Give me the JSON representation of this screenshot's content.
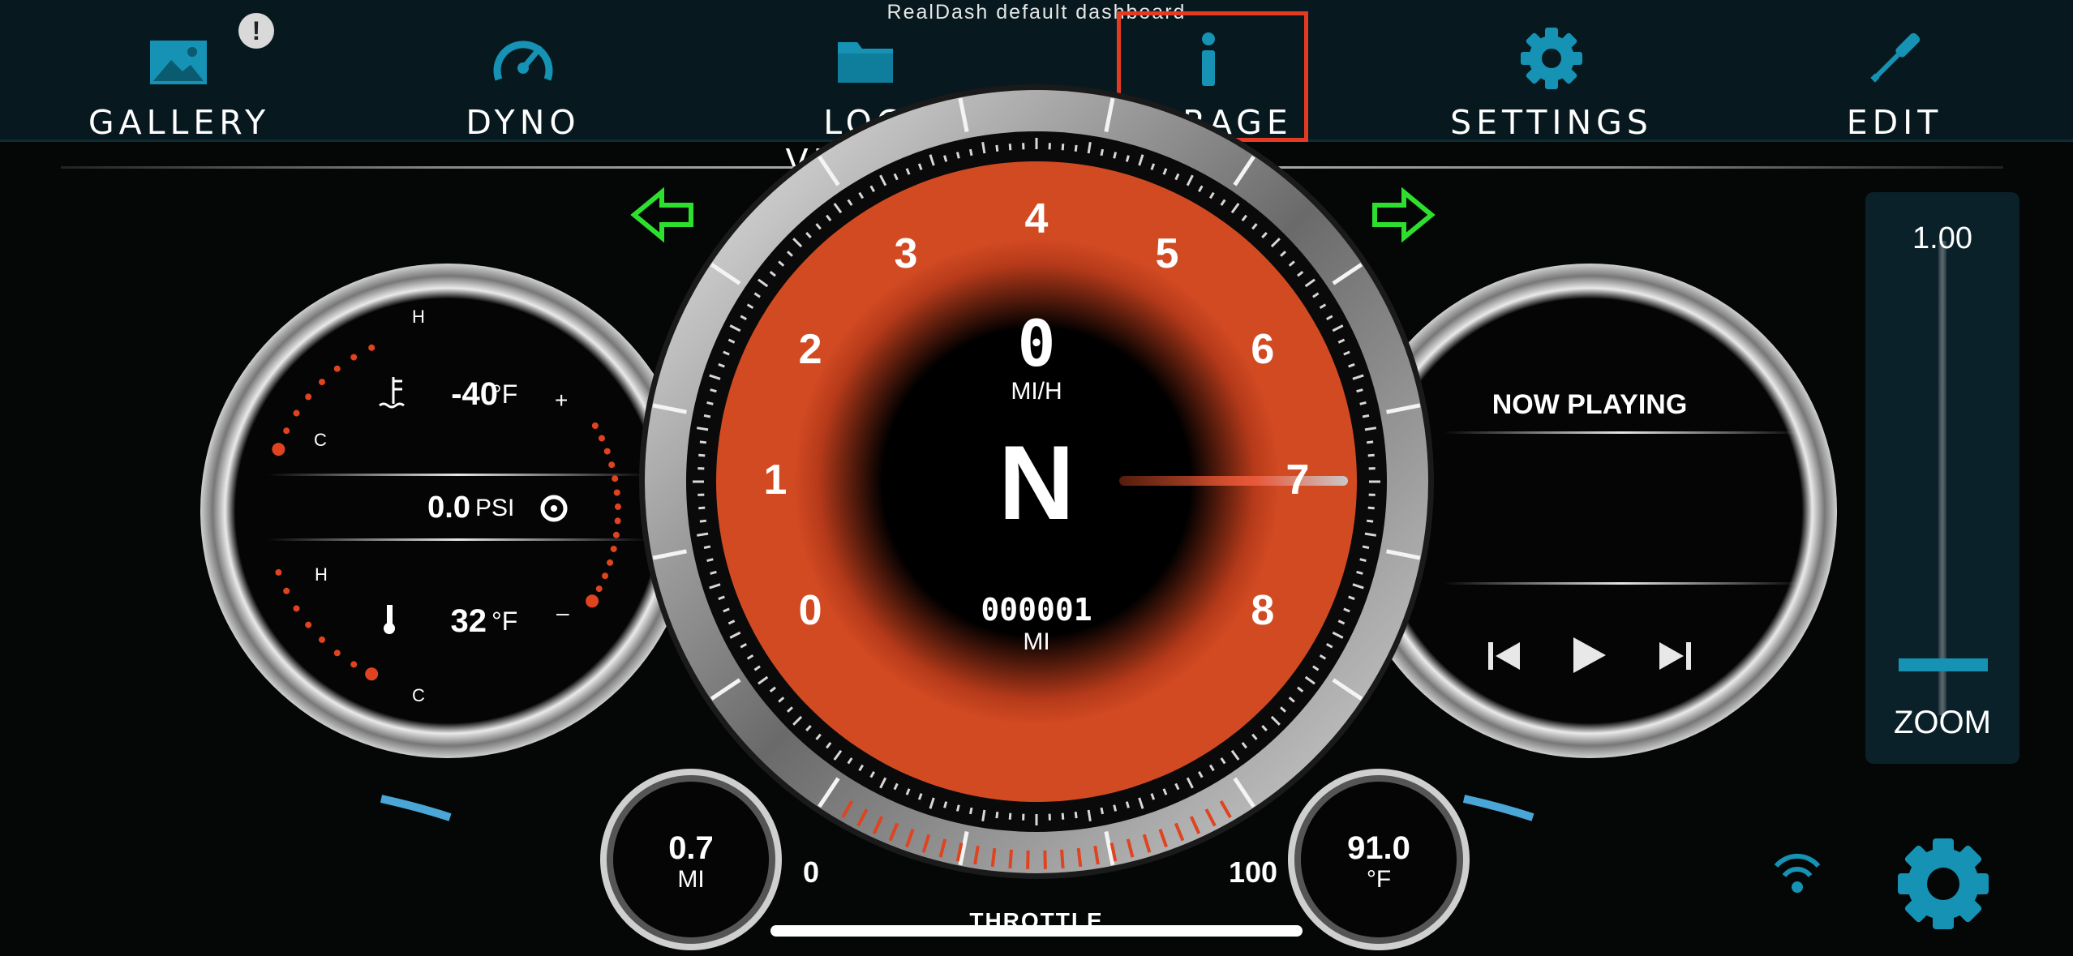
{
  "header": {
    "title": "RealDash default dashboard"
  },
  "nav": {
    "items": [
      {
        "label": "GALLERY",
        "icon": "image-icon"
      },
      {
        "label": "DYNO",
        "icon": "gauge-icon"
      },
      {
        "label": "LOG VIEWER",
        "icon": "folder-icon"
      },
      {
        "label": "GARAGE",
        "icon": "info-icon"
      },
      {
        "label": "SETTINGS",
        "icon": "gear-icon"
      },
      {
        "label": "EDIT",
        "icon": "screwdriver-icon"
      }
    ],
    "alert_badge": "!"
  },
  "left_gauge": {
    "coolant_value": "-40",
    "coolant_unit": "°F",
    "coolant_high": "H",
    "coolant_low": "C",
    "plus": "+",
    "boost_value": "0.0",
    "boost_unit": "PSI",
    "temp_value": "32",
    "temp_unit": "°F",
    "temp_high": "H",
    "temp_low": "C",
    "minus": "–"
  },
  "tach": {
    "numbers": [
      "0",
      "1",
      "2",
      "3",
      "4",
      "5",
      "6",
      "7",
      "8"
    ],
    "speed": "0",
    "speed_unit": "MI/H",
    "gear": "N",
    "odometer": "000001",
    "odometer_unit": "MI"
  },
  "throttle": {
    "min": "0",
    "max": "100",
    "label": "THROTTLE"
  },
  "trip": {
    "value": "0.7",
    "unit": "MI"
  },
  "outside_temp": {
    "value": "91.0",
    "unit": "°F"
  },
  "media": {
    "now_playing": "NOW PLAYING",
    "prev_icon": "skip-previous-icon",
    "play_icon": "play-icon",
    "next_icon": "skip-next-icon"
  },
  "zoom": {
    "value": "1.00",
    "label": "ZOOM",
    "level_fraction": 0.0
  },
  "colors": {
    "accent": "#1592b4",
    "tach_red": "#d24a22",
    "turn_signal": "#2ee02e",
    "highlight": "#e53a22"
  }
}
